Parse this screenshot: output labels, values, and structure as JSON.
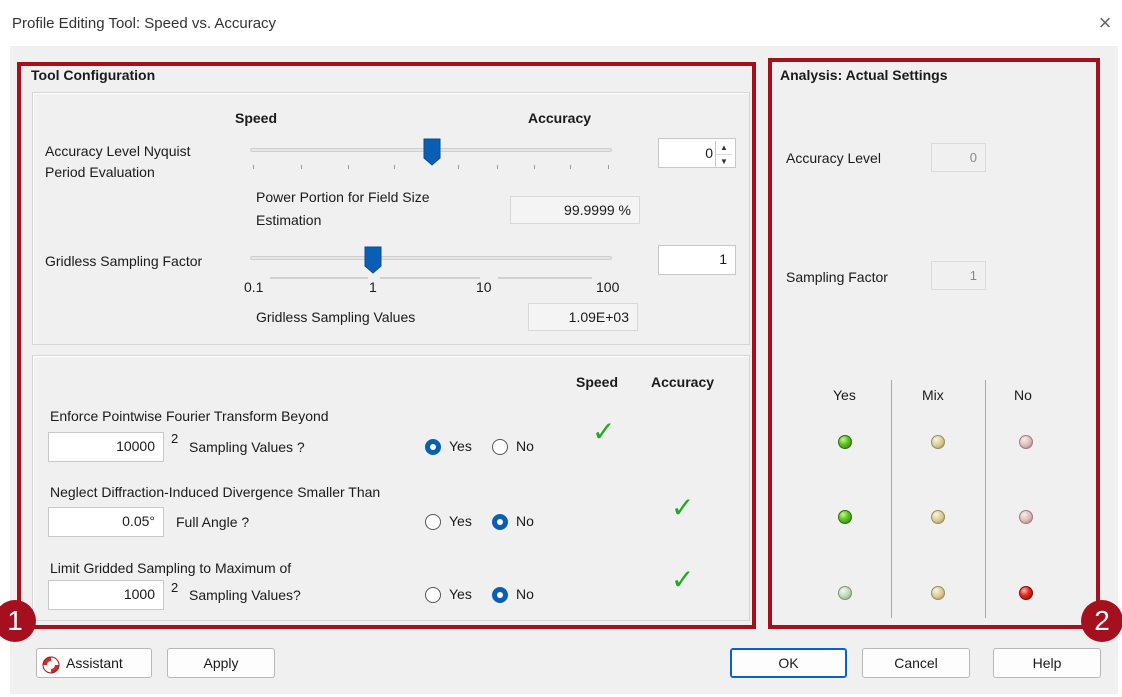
{
  "window": {
    "title": "Profile Editing Tool: Speed vs. Accuracy",
    "close_glyph": "×"
  },
  "config": {
    "group_title": "Tool Configuration",
    "slider_speed_label": "Speed",
    "slider_accuracy_label": "Accuracy",
    "accuracy_label": "Accuracy Level Nyquist Period Evaluation",
    "accuracy_label_line1": "Accuracy Level Nyquist",
    "accuracy_label_line2": "Period Evaluation",
    "accuracy_value": "0",
    "accuracy_slider_position": 0.5,
    "power_label_line1": "Power Portion for Field Size",
    "power_label_line2": "Estimation",
    "power_value": "99.9999 %",
    "gridless_label": "Gridless Sampling Factor",
    "gridless_value": "1",
    "gridless_slider_value": 1,
    "gridless_scale": [
      "0.1",
      "1",
      "10",
      "100"
    ],
    "gridless_values_label": "Gridless Sampling Values",
    "gridless_values_value": "1.09E+03",
    "col_speed": "Speed",
    "col_accuracy": "Accuracy",
    "options": [
      {
        "question": "Enforce Pointwise Fourier Transform Beyond",
        "value": "10000",
        "superscript": "2",
        "suffix": "Sampling Values ?",
        "yes_label": "Yes",
        "no_label": "No",
        "selected": "Yes",
        "check_column": "Speed"
      },
      {
        "question": "Neglect Diffraction-Induced Divergence Smaller Than",
        "value": "0.05°",
        "superscript": "",
        "suffix": "Full Angle ?",
        "yes_label": "Yes",
        "no_label": "No",
        "selected": "No",
        "check_column": "Accuracy"
      },
      {
        "question": "Limit Gridded Sampling to Maximum of",
        "value": "1000",
        "superscript": "2",
        "suffix": "Sampling Values?",
        "yes_label": "Yes",
        "no_label": "No",
        "selected": "No",
        "check_column": "Accuracy"
      }
    ],
    "check_glyph": "✓"
  },
  "analysis": {
    "group_title": "Analysis: Actual Settings",
    "accuracy_label": "Accuracy Level",
    "accuracy_value": "0",
    "sampling_label": "Sampling Factor",
    "sampling_value": "1",
    "col_yes": "Yes",
    "col_mix": "Mix",
    "col_no": "No",
    "indicators": [
      {
        "yes": "on",
        "mix": "off",
        "no": "off"
      },
      {
        "yes": "on",
        "mix": "off",
        "no": "off"
      },
      {
        "yes": "off",
        "mix": "off",
        "no": "on"
      }
    ],
    "colors": {
      "yes_on": "#5cc21c",
      "no_on": "#e3241a",
      "frame": "#a50f1e"
    }
  },
  "buttons": {
    "assistant": "Assistant",
    "apply": "Apply",
    "ok": "OK",
    "cancel": "Cancel",
    "help": "Help"
  },
  "badges": {
    "one": "1",
    "two": "2"
  }
}
